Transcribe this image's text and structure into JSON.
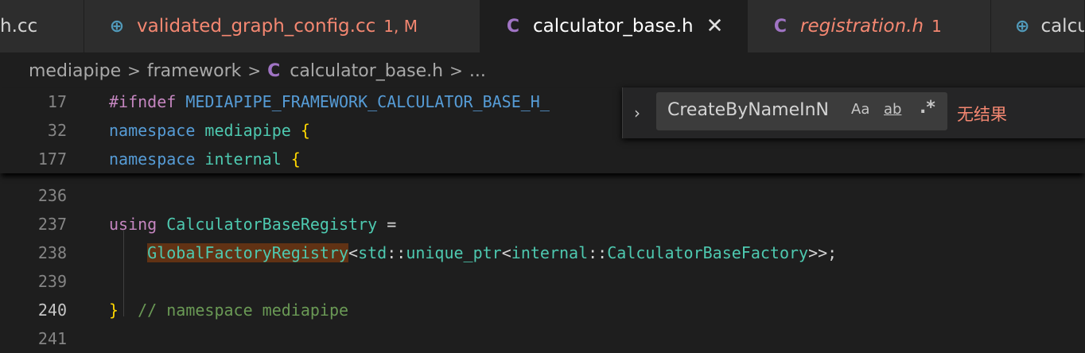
{
  "tabs": [
    {
      "label": "h.cc",
      "badge": "",
      "icon": "",
      "color": "#d4d4d4"
    },
    {
      "label": "validated_graph_config.cc",
      "badge": "1, M",
      "icon": "C+",
      "color": "#f48771"
    },
    {
      "label": "calculator_base.h",
      "badge": "",
      "icon": "C",
      "color": "#ffffff",
      "close": "✕"
    },
    {
      "label": "registration.h",
      "badge": "1",
      "icon": "C",
      "color": "#f48771"
    },
    {
      "label": "calcu",
      "badge": "",
      "icon": "C+",
      "color": "#d4d4d4"
    }
  ],
  "breadcrumb": {
    "items": [
      "mediapipe",
      "framework",
      "calculator_base.h",
      "..."
    ],
    "separator": ">",
    "file_icon": "C"
  },
  "sticky_lines": [
    {
      "num": "17",
      "tokens": [
        {
          "t": "#ifndef ",
          "c": "p"
        },
        {
          "t": "MEDIAPIPE_FRAMEWORK_CALCULATOR_BASE_H_",
          "c": "m"
        }
      ]
    },
    {
      "num": "32",
      "tokens": [
        {
          "t": "namespace ",
          "c": "k"
        },
        {
          "t": "mediapipe ",
          "c": "n"
        },
        {
          "t": "{",
          "c": "b"
        }
      ]
    },
    {
      "num": "177",
      "tokens": [
        {
          "t": "namespace ",
          "c": "k"
        },
        {
          "t": "internal ",
          "c": "n"
        },
        {
          "t": "{",
          "c": "b"
        }
      ]
    }
  ],
  "code_lines": [
    {
      "num": "236",
      "tokens": []
    },
    {
      "num": "237",
      "tokens": [
        {
          "t": "using ",
          "c": "p"
        },
        {
          "t": "CalculatorBaseRegistry",
          "c": "t"
        },
        {
          "t": " =",
          "c": "o"
        }
      ]
    },
    {
      "num": "238",
      "tokens": [
        {
          "t": "    ",
          "c": "o"
        },
        {
          "t": "GlobalFactoryRegistry",
          "c": "t",
          "hl": true
        },
        {
          "t": "<",
          "c": "o"
        },
        {
          "t": "std",
          "c": "t"
        },
        {
          "t": "::",
          "c": "o"
        },
        {
          "t": "unique_ptr",
          "c": "t"
        },
        {
          "t": "<",
          "c": "o"
        },
        {
          "t": "internal",
          "c": "t"
        },
        {
          "t": "::",
          "c": "o"
        },
        {
          "t": "CalculatorBaseFactory",
          "c": "t"
        },
        {
          "t": ">>;",
          "c": "o"
        }
      ]
    },
    {
      "num": "239",
      "tokens": []
    },
    {
      "num": "240",
      "tokens": [
        {
          "t": "}",
          "c": "b"
        },
        {
          "t": "  // namespace mediapipe",
          "c": "c"
        }
      ]
    },
    {
      "num": "241",
      "tokens": []
    }
  ],
  "current_line": "240",
  "find": {
    "value": "CreateByNameInN",
    "toggle_icon": "chevron-right-icon",
    "match_case": "Aa",
    "whole_word": "ab",
    "regex": ".*",
    "result": "无结果"
  },
  "colors": {
    "accent_error": "#f48771",
    "c_icon": "#a074c4",
    "cpp_icon": "#519aba"
  }
}
